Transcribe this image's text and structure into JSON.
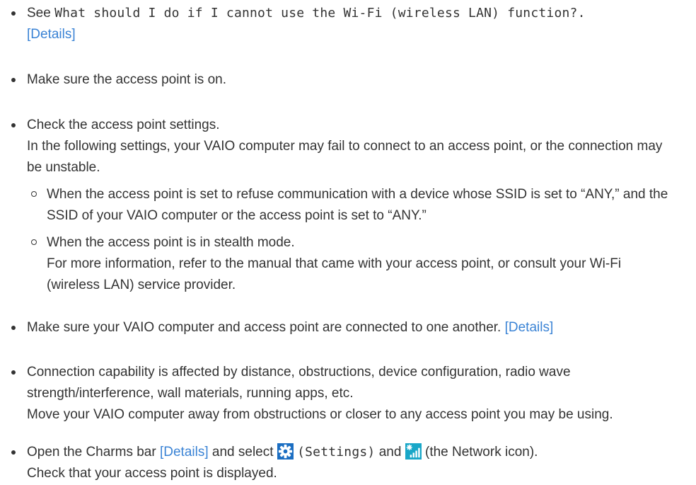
{
  "items": {
    "i1": {
      "prefix": "See ",
      "title": "What should I do if I cannot use the Wi-Fi (wireless LAN) function?.",
      "link": "[Details]"
    },
    "i2": {
      "text": "Make sure the access point is on."
    },
    "i3": {
      "line1": "Check the access point settings.",
      "line2": "In the following settings, your VAIO computer may fail to connect to an access point, or the connection may be unstable.",
      "sub": [
        {
          "text": "When the access point is set to refuse communication with a device whose SSID is set to “ANY,” and the SSID of your VAIO computer or the access point is set to “ANY.”"
        },
        {
          "line1": "When the access point is in stealth mode.",
          "line2": "For more information, refer to the manual that came with your access point, or consult your Wi-Fi (wireless LAN) service provider."
        }
      ]
    },
    "i4": {
      "text": "Make sure your VAIO computer and access point are connected to one another. ",
      "link": "[Details]"
    },
    "i5": {
      "line1": "Connection capability is affected by distance, obstructions, device configuration, radio wave strength/interference, wall materials, running apps, etc.",
      "line2": "Move your VAIO computer away from obstructions or closer to any access point you may be using."
    },
    "i6": {
      "t1": "Open the Charms bar ",
      "link": "[Details]",
      "t2": " and select ",
      "settings_label": "(Settings)",
      "t3": " and ",
      "t4": " (the Network icon).",
      "line2": "Check that your access point is displayed."
    }
  },
  "icons": {
    "settings": "gear-icon",
    "network": "network-icon"
  },
  "colors": {
    "link": "#3a83d5",
    "text": "#333333",
    "settings_bg": "#1b6ec2",
    "network_bg": "#19a7c8"
  }
}
